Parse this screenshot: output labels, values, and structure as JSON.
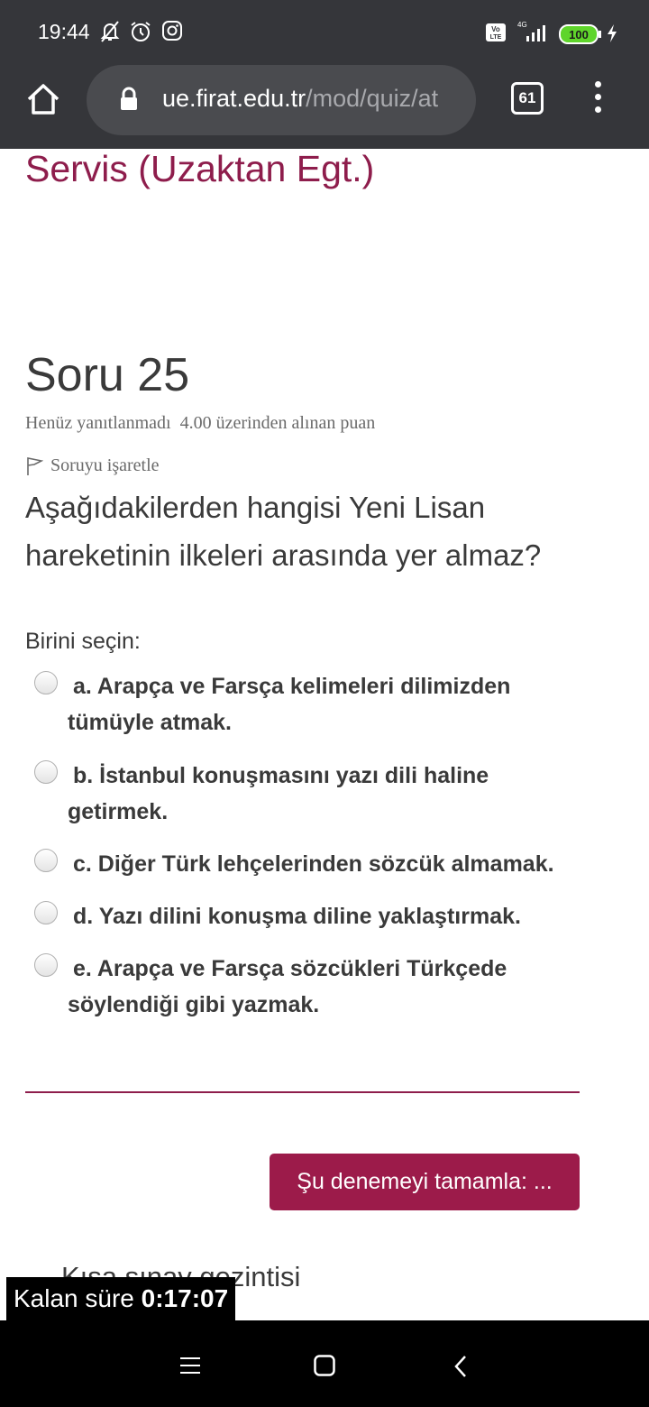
{
  "status_bar": {
    "time": "19:44",
    "network": "4G",
    "volte": "Vo LTE",
    "battery": "100",
    "icons": [
      "bell-off-icon",
      "alarm-icon",
      "instagram-icon",
      "volte-icon",
      "signal-icon",
      "battery-icon",
      "charging-icon"
    ]
  },
  "browser": {
    "url_host": "ue.firat.edu.tr",
    "url_path": "/mod/quiz/at",
    "tab_count": "61"
  },
  "page": {
    "course_title": "Servis (Uzaktan Egt.)",
    "question": {
      "title": "Soru 25",
      "state": "Henüz yanıtlanmadı",
      "grade": "4.00 üzerinden alınan puan",
      "flag_label": "Soruyu işaretle",
      "text": "Aşağıdakilerden hangisi Yeni Lisan hareketinin ilkeleri arasında yer almaz?",
      "prompt": "Birini seçin:",
      "options": [
        {
          "label": "a. Arapça ve Farsça kelimeleri dilimizden tümüyle atmak."
        },
        {
          "label": "b. İstanbul konuşmasını yazı dili haline getirmek."
        },
        {
          "label": "c. Diğer Türk lehçelerinden sözcük almamak."
        },
        {
          "label": "d. Yazı dilini konuşma diline yaklaştırmak."
        },
        {
          "label": "e. Arapça ve Farsça sözcükleri Türkçede söylendiği gibi yazmak."
        }
      ]
    },
    "finish_button": "Şu denemeyi tamamla: ...",
    "navigation_title": "Kısa sınav gezintisi",
    "timer": {
      "label": "Kalan süre",
      "value": "0:17:07"
    }
  },
  "colors": {
    "brand": "#8e1d4c",
    "button": "#9c1b4a",
    "chrome": "#35363a"
  }
}
